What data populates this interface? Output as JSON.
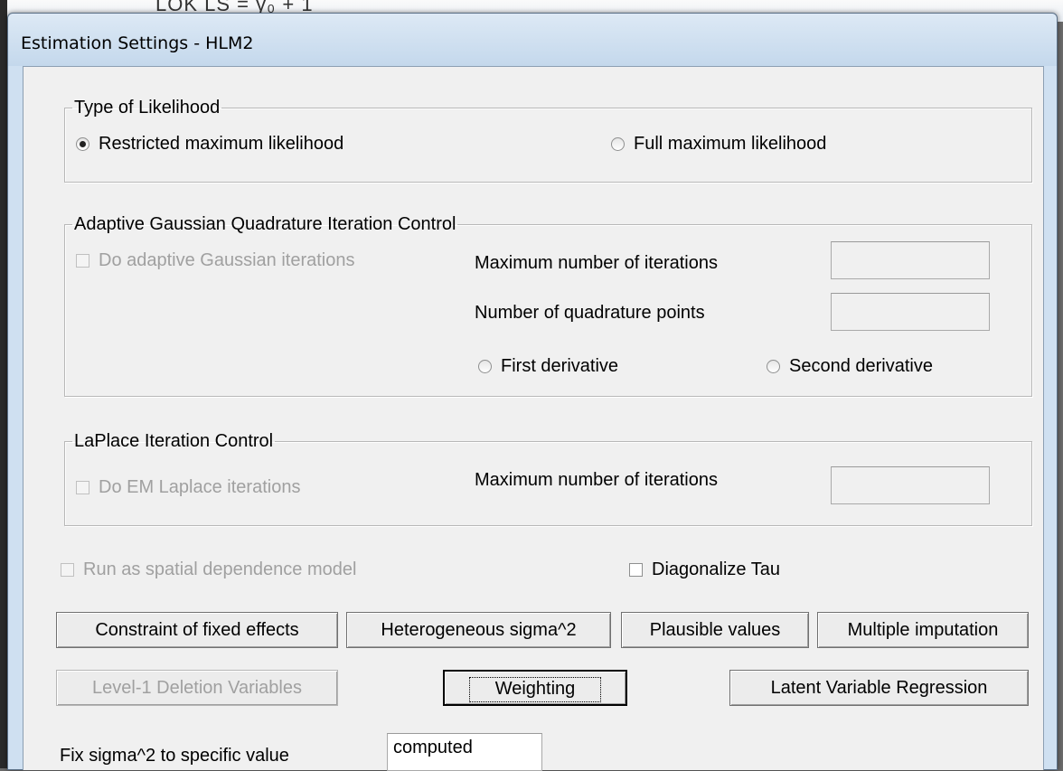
{
  "background": {
    "partial_text": "LOK LS = γ₀ + 1"
  },
  "window": {
    "title": "Estimation Settings - HLM2"
  },
  "likelihood": {
    "legend": "Type of Likelihood",
    "restricted_label": "Restricted maximum likelihood",
    "restricted_selected": true,
    "full_label": "Full maximum likelihood",
    "full_selected": false
  },
  "agq": {
    "legend": "Adaptive Gaussian Quadrature Iteration Control",
    "do_iterations_label": "Do adaptive Gaussian  iterations",
    "max_iterations_label": "Maximum number of  iterations",
    "max_iterations_value": "",
    "quad_points_label": "Number of quadrature points",
    "quad_points_value": "",
    "first_derivative_label": "First derivative",
    "second_derivative_label": "Second derivative"
  },
  "laplace": {
    "legend": "LaPlace Iteration Control",
    "do_em_label": "Do  EM Laplace iterations",
    "max_iterations_label": "Maximum number of iterations",
    "max_iterations_value": ""
  },
  "options": {
    "spatial_label": "Run as spatial dependence model",
    "diagonalize_label": "Diagonalize Tau"
  },
  "buttons": {
    "constraint": "Constraint of fixed effects",
    "heterogeneous": "Heterogeneous sigma^2",
    "plausible": "Plausible values",
    "multiple_imputation": "Multiple imputation",
    "level1_deletion": "Level-1 Deletion Variables",
    "weighting": "Weighting",
    "latent": "Latent Variable Regression"
  },
  "sigma": {
    "label": "Fix sigma^2 to specific value",
    "value": "computed"
  },
  "colors": {
    "dialog_bg": "#f0f0f0",
    "frame_bg": "#cfe0f1",
    "disabled_text": "#a0a0a0"
  }
}
